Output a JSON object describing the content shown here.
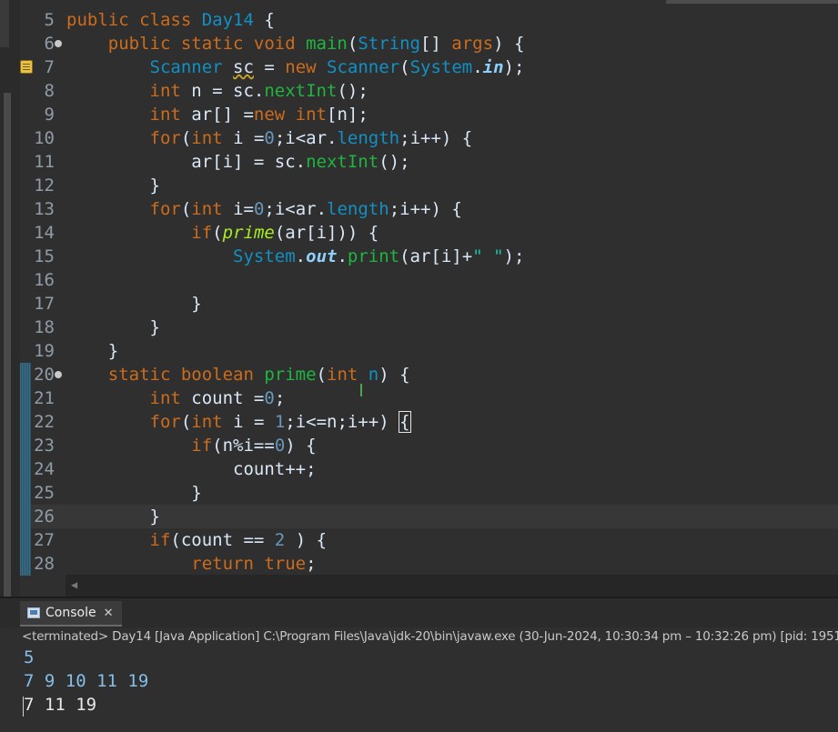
{
  "editor": {
    "lines": [
      {
        "num": "5",
        "segments": [
          {
            "t": "public class ",
            "c": "kw"
          },
          {
            "t": "Day14",
            "c": "ty"
          },
          {
            "t": " {",
            "c": ""
          }
        ]
      },
      {
        "num": "6",
        "fold": true,
        "segments": [
          {
            "t": "    public static void ",
            "c": "kw"
          },
          {
            "t": "main",
            "c": "mt"
          },
          {
            "t": "(",
            "c": ""
          },
          {
            "t": "String",
            "c": "ty"
          },
          {
            "t": "[] ",
            "c": ""
          },
          {
            "t": "args",
            "c": "kw"
          },
          {
            "t": ") {",
            "c": ""
          }
        ]
      },
      {
        "num": "7",
        "warn": true,
        "segments": [
          {
            "t": "        ",
            "c": ""
          },
          {
            "t": "Scanner",
            "c": "ty"
          },
          {
            "t": " ",
            "c": ""
          },
          {
            "t": "sc",
            "c": "squig"
          },
          {
            "t": " = ",
            "c": ""
          },
          {
            "t": "new ",
            "c": "kw"
          },
          {
            "t": "Scanner",
            "c": "ty"
          },
          {
            "t": "(",
            "c": ""
          },
          {
            "t": "System",
            "c": "ty"
          },
          {
            "t": ".",
            "c": ""
          },
          {
            "t": "in",
            "c": "fd"
          },
          {
            "t": ");",
            "c": ""
          }
        ]
      },
      {
        "num": "8",
        "segments": [
          {
            "t": "        ",
            "c": ""
          },
          {
            "t": "int",
            "c": "kw"
          },
          {
            "t": " n = sc.",
            "c": ""
          },
          {
            "t": "nextInt",
            "c": "mt"
          },
          {
            "t": "();",
            "c": ""
          }
        ]
      },
      {
        "num": "9",
        "segments": [
          {
            "t": "        ",
            "c": ""
          },
          {
            "t": "int",
            "c": "kw"
          },
          {
            "t": " ar[] =",
            "c": ""
          },
          {
            "t": "new int",
            "c": "kw"
          },
          {
            "t": "[n];",
            "c": ""
          }
        ]
      },
      {
        "num": "10",
        "segments": [
          {
            "t": "        ",
            "c": ""
          },
          {
            "t": "for",
            "c": "kw"
          },
          {
            "t": "(",
            "c": ""
          },
          {
            "t": "int",
            "c": "kw"
          },
          {
            "t": " i =",
            "c": ""
          },
          {
            "t": "0",
            "c": "num"
          },
          {
            "t": ";i<ar.",
            "c": ""
          },
          {
            "t": "length",
            "c": "ty"
          },
          {
            "t": ";i++) {",
            "c": ""
          }
        ]
      },
      {
        "num": "11",
        "segments": [
          {
            "t": "            ar[i] = sc.",
            "c": ""
          },
          {
            "t": "nextInt",
            "c": "mt"
          },
          {
            "t": "();",
            "c": ""
          }
        ]
      },
      {
        "num": "12",
        "segments": [
          {
            "t": "        }",
            "c": ""
          }
        ]
      },
      {
        "num": "13",
        "segments": [
          {
            "t": "        ",
            "c": ""
          },
          {
            "t": "for",
            "c": "kw"
          },
          {
            "t": "(",
            "c": ""
          },
          {
            "t": "int",
            "c": "kw"
          },
          {
            "t": " i=",
            "c": ""
          },
          {
            "t": "0",
            "c": "num"
          },
          {
            "t": ";i<ar.",
            "c": ""
          },
          {
            "t": "length",
            "c": "ty"
          },
          {
            "t": ";i++) {",
            "c": ""
          }
        ]
      },
      {
        "num": "14",
        "segments": [
          {
            "t": "            ",
            "c": ""
          },
          {
            "t": "if",
            "c": "kw"
          },
          {
            "t": "(",
            "c": ""
          },
          {
            "t": "prime",
            "c": "ita"
          },
          {
            "t": "(ar[i])) {",
            "c": ""
          }
        ]
      },
      {
        "num": "15",
        "segments": [
          {
            "t": "                ",
            "c": ""
          },
          {
            "t": "System",
            "c": "ty"
          },
          {
            "t": ".",
            "c": ""
          },
          {
            "t": "out",
            "c": "fd"
          },
          {
            "t": ".",
            "c": ""
          },
          {
            "t": "print",
            "c": "mt"
          },
          {
            "t": "(ar[i]+",
            "c": ""
          },
          {
            "t": "\" \"",
            "c": "str"
          },
          {
            "t": ");",
            "c": ""
          }
        ]
      },
      {
        "num": "16",
        "segments": []
      },
      {
        "num": "17",
        "segments": [
          {
            "t": "            }",
            "c": ""
          }
        ]
      },
      {
        "num": "18",
        "segments": [
          {
            "t": "        }",
            "c": ""
          }
        ]
      },
      {
        "num": "19",
        "segments": [
          {
            "t": "    }",
            "c": ""
          }
        ]
      },
      {
        "num": "20",
        "fold": true,
        "marked": true,
        "segments": [
          {
            "t": "    static boolean ",
            "c": "kw"
          },
          {
            "t": "prime",
            "c": "mt"
          },
          {
            "t": "(",
            "c": ""
          },
          {
            "t": "int",
            "c": "kw"
          },
          {
            "t": " ",
            "c": ""
          },
          {
            "t": "n",
            "c": "ty"
          },
          {
            "t": ") {",
            "c": ""
          }
        ]
      },
      {
        "num": "21",
        "marked": true,
        "segments": [
          {
            "t": "        ",
            "c": ""
          },
          {
            "t": "int",
            "c": "kw"
          },
          {
            "t": " count =",
            "c": ""
          },
          {
            "t": "0",
            "c": "num"
          },
          {
            "t": ";",
            "c": ""
          }
        ]
      },
      {
        "num": "22",
        "marked": true,
        "segments": [
          {
            "t": "        ",
            "c": ""
          },
          {
            "t": "for",
            "c": "kw"
          },
          {
            "t": "(",
            "c": ""
          },
          {
            "t": "int",
            "c": "kw"
          },
          {
            "t": " i = ",
            "c": ""
          },
          {
            "t": "1",
            "c": "num"
          },
          {
            "t": ";i<=n;i++) ",
            "c": ""
          },
          {
            "t": "{",
            "c": "bracket-box"
          }
        ]
      },
      {
        "num": "23",
        "marked": true,
        "segments": [
          {
            "t": "            ",
            "c": ""
          },
          {
            "t": "if",
            "c": "kw"
          },
          {
            "t": "(n%i==",
            "c": ""
          },
          {
            "t": "0",
            "c": "num"
          },
          {
            "t": ") {",
            "c": ""
          }
        ]
      },
      {
        "num": "24",
        "marked": true,
        "segments": [
          {
            "t": "                count++;",
            "c": ""
          }
        ]
      },
      {
        "num": "25",
        "marked": true,
        "segments": [
          {
            "t": "            }",
            "c": ""
          }
        ]
      },
      {
        "num": "26",
        "marked": true,
        "current": true,
        "segments": [
          {
            "t": "        }",
            "c": ""
          }
        ]
      },
      {
        "num": "27",
        "marked": true,
        "segments": [
          {
            "t": "        ",
            "c": ""
          },
          {
            "t": "if",
            "c": "kw"
          },
          {
            "t": "(count == ",
            "c": ""
          },
          {
            "t": "2",
            "c": "num"
          },
          {
            "t": " ) {",
            "c": ""
          }
        ]
      },
      {
        "num": "28",
        "marked": true,
        "segments": [
          {
            "t": "            ",
            "c": ""
          },
          {
            "t": "return true",
            "c": "kw"
          },
          {
            "t": ";",
            "c": ""
          }
        ]
      }
    ]
  },
  "console": {
    "tab_label": "Console",
    "close_glyph": "✕",
    "status": "<terminated> Day14 [Java Application] C:\\Program Files\\Java\\jdk-20\\bin\\javaw.exe  (30-Jun-2024, 10:30:34 pm – 10:32:26 pm) [pid: 1951",
    "input_lines": [
      "5",
      "7 9 10 11 19"
    ],
    "output_line": "7 11 19"
  },
  "icons": {
    "fold": "fold-collapse-icon",
    "warning": "warning-icon",
    "console": "console-icon",
    "close": "close-icon",
    "scroll_left": "scroll-left-arrow-icon"
  },
  "colors": {
    "keyword": "#cc6c1d",
    "type": "#1290c3",
    "method": "#1eb540",
    "field": "#8dd1fa",
    "number": "#6897bb",
    "string": "#17c6a3",
    "console_input": "#85bee8"
  }
}
